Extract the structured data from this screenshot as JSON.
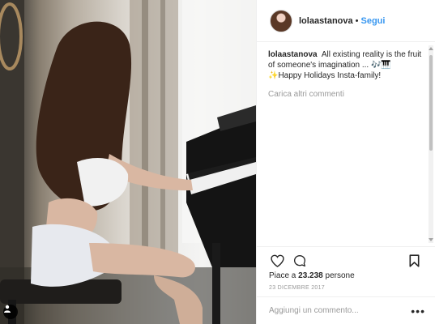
{
  "header": {
    "username": "lolaastanova",
    "separator": "•",
    "follow_label": "Segui"
  },
  "caption": {
    "username": "lolaastanova",
    "text": "All existing reality is the fruit of someone's imagination ... 🎶🎹✨Happy Holidays Insta-family!"
  },
  "comments": {
    "load_more": "Carica altri commenti"
  },
  "actions": {
    "like_icon": "heart-icon",
    "comment_icon": "comment-icon",
    "save_icon": "bookmark-icon"
  },
  "likes": {
    "prefix": "Piace a",
    "count": "23.238",
    "suffix": "persone"
  },
  "date": "23 DICEMBRE 2017",
  "comment_input": {
    "placeholder": "Aggiungi un commento...",
    "more_label": "•••"
  },
  "photo": {
    "user_tag_icon": "person-icon"
  }
}
